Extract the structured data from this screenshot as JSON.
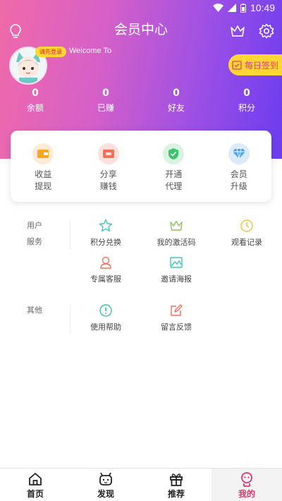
{
  "status": {
    "time": "10:49"
  },
  "header": {
    "title": "会员中心"
  },
  "user": {
    "login_badge": "请先登录",
    "welcome": "Welcome To"
  },
  "checkin": {
    "label": "每日签到"
  },
  "stats": [
    {
      "value": "0",
      "label": "余额"
    },
    {
      "value": "0",
      "label": "已赚"
    },
    {
      "value": "0",
      "label": "好友"
    },
    {
      "value": "0",
      "label": "积分"
    }
  ],
  "quick_actions": [
    {
      "line1": "收益",
      "line2": "提现",
      "icon": "wallet-icon",
      "color": "#f5a623"
    },
    {
      "line1": "分享",
      "line2": "赚钱",
      "icon": "share-icon",
      "color": "#f0705a"
    },
    {
      "line1": "开通",
      "line2": "代理",
      "icon": "shield-check-icon",
      "color": "#3cc36b"
    },
    {
      "line1": "会员",
      "line2": "升级",
      "icon": "diamond-icon",
      "color": "#4aa5f0"
    }
  ],
  "user_services": {
    "label_line1": "用户",
    "label_line2": "服务",
    "items": [
      {
        "label": "积分兑换",
        "icon": "star-icon"
      },
      {
        "label": "我的激活码",
        "icon": "crown-icon"
      },
      {
        "label": "观看记录",
        "icon": "clock-icon"
      },
      {
        "label": "专属客服",
        "icon": "user-support-icon"
      },
      {
        "label": "邀请海报",
        "icon": "image-icon"
      }
    ]
  },
  "other": {
    "label": "其他",
    "items": [
      {
        "label": "使用帮助",
        "icon": "help-icon"
      },
      {
        "label": "留言反馈",
        "icon": "feedback-icon"
      }
    ]
  },
  "tabs": [
    {
      "label": "首页",
      "icon": "home-icon"
    },
    {
      "label": "发现",
      "icon": "discover-icon"
    },
    {
      "label": "推荐",
      "icon": "gift-icon"
    },
    {
      "label": "我的",
      "icon": "profile-icon",
      "active": true
    }
  ],
  "colors": {
    "accent": "#e6336b",
    "gradient_start": "#f06aa8",
    "gradient_end": "#6b3cf0",
    "badge": "#ffd633"
  }
}
